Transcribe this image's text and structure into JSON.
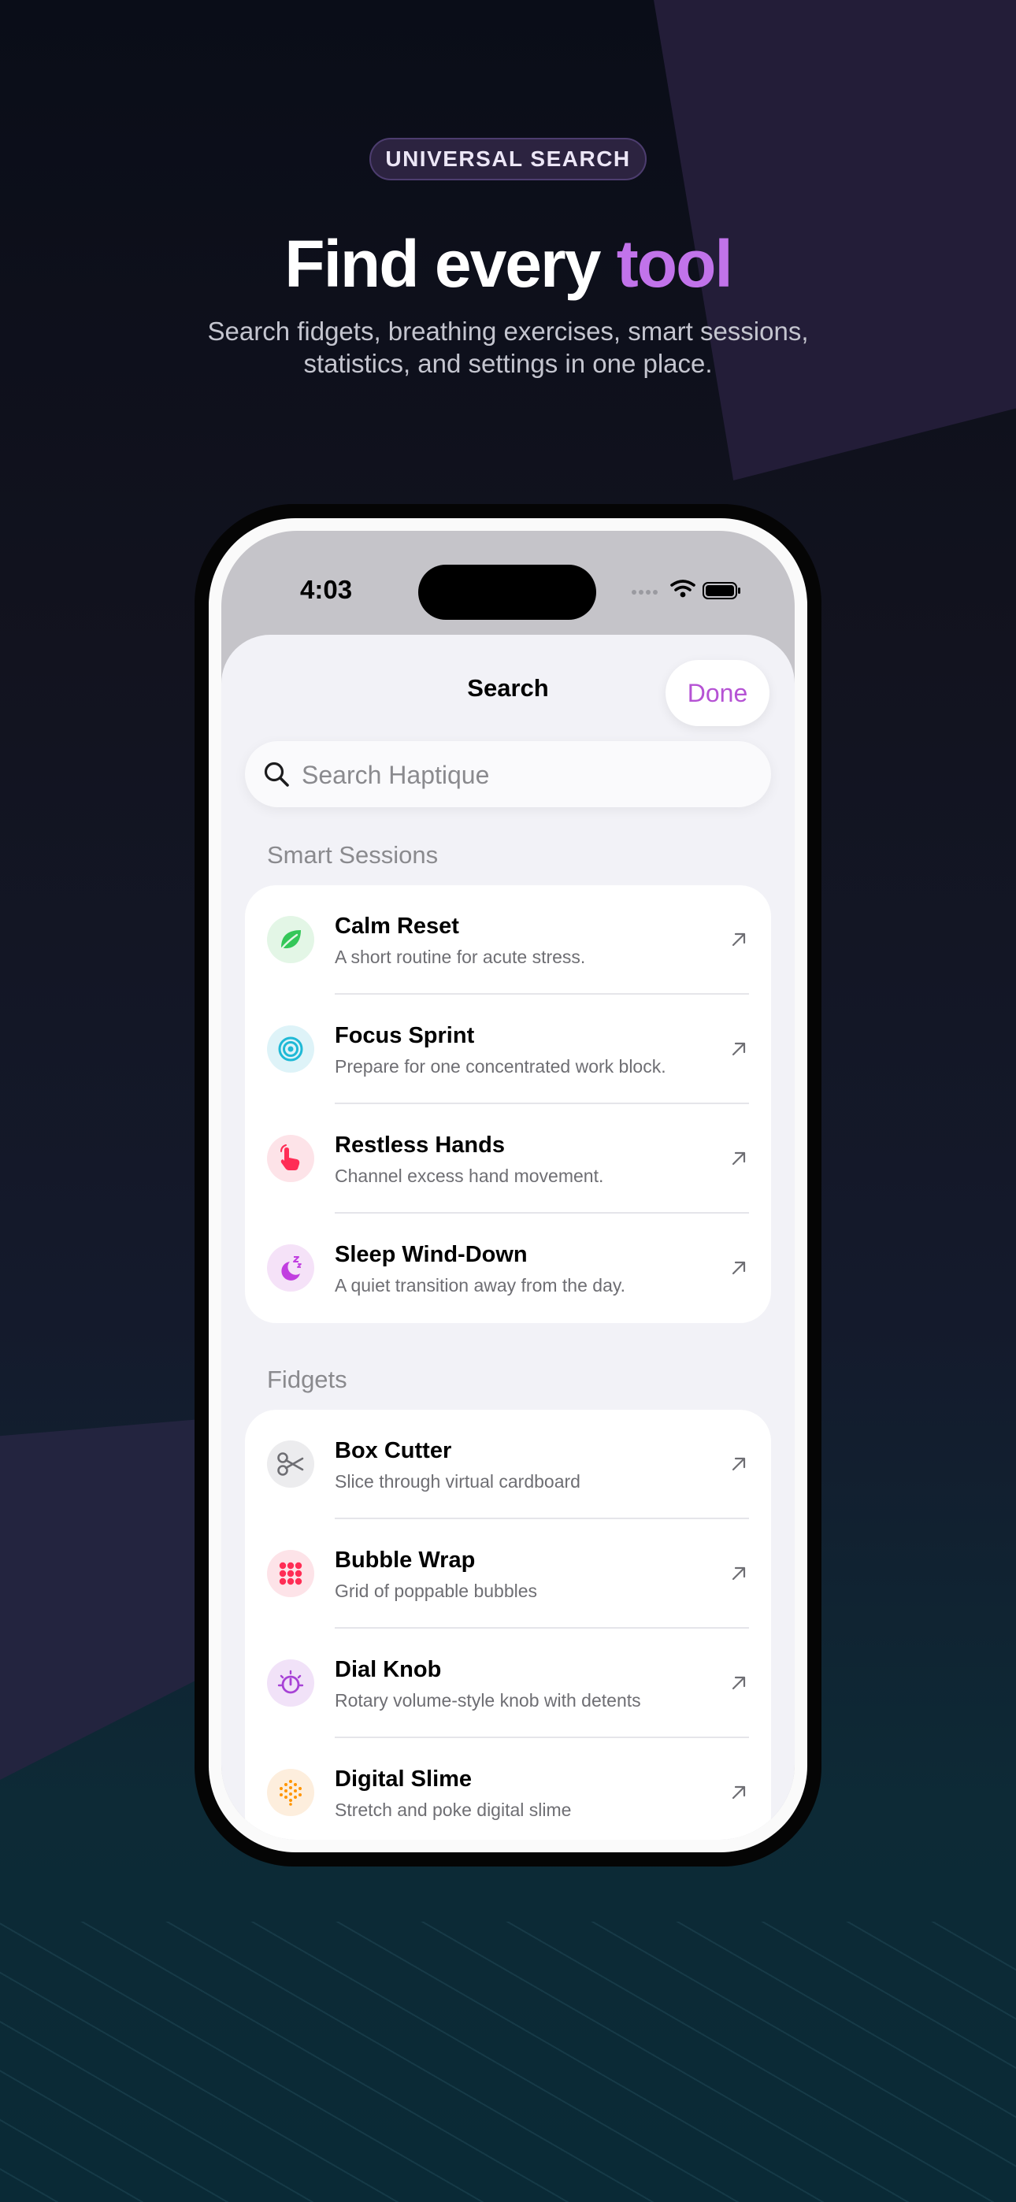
{
  "hero": {
    "badge": "UNIVERSAL SEARCH",
    "headline_main": "Find every ",
    "headline_accent": "tool",
    "subtitle": "Search fidgets, breathing exercises, smart sessions, statistics, and settings in one place."
  },
  "status_bar": {
    "time": "4:03"
  },
  "sheet": {
    "title": "Search",
    "done_label": "Done"
  },
  "search": {
    "placeholder": "Search Haptique",
    "value": ""
  },
  "sections": [
    {
      "header": "Smart Sessions",
      "items": [
        {
          "title": "Calm Reset",
          "subtitle": "A short routine for acute stress.",
          "icon": "leaf-icon",
          "color": "#34c759",
          "bg": "#e3f6e6"
        },
        {
          "title": "Focus Sprint",
          "subtitle": "Prepare for one concentrated work block.",
          "icon": "target-icon",
          "color": "#1fb9d6",
          "bg": "#def3f8"
        },
        {
          "title": "Restless Hands",
          "subtitle": "Channel excess hand movement.",
          "icon": "hand-tap-icon",
          "color": "#ff2d55",
          "bg": "#fde3e8"
        },
        {
          "title": "Sleep Wind-Down",
          "subtitle": "A quiet transition away from the day.",
          "icon": "moon-zzz-icon",
          "color": "#c13ee0",
          "bg": "#f5e2f8"
        }
      ]
    },
    {
      "header": "Fidgets",
      "items": [
        {
          "title": "Box Cutter",
          "subtitle": "Slice through virtual cardboard",
          "icon": "scissors-icon",
          "color": "#6e6e73",
          "bg": "#ececee"
        },
        {
          "title": "Bubble Wrap",
          "subtitle": "Grid of poppable bubbles",
          "icon": "bubble-grid-icon",
          "color": "#ff2d55",
          "bg": "#fde3e8"
        },
        {
          "title": "Dial Knob",
          "subtitle": "Rotary volume-style knob with detents",
          "icon": "dial-icon",
          "color": "#a742d6",
          "bg": "#f1e2f8"
        },
        {
          "title": "Digital Slime",
          "subtitle": "Stretch and poke digital slime",
          "icon": "dots-blob-icon",
          "color": "#ff9500",
          "bg": "#fdeedd"
        }
      ]
    }
  ]
}
